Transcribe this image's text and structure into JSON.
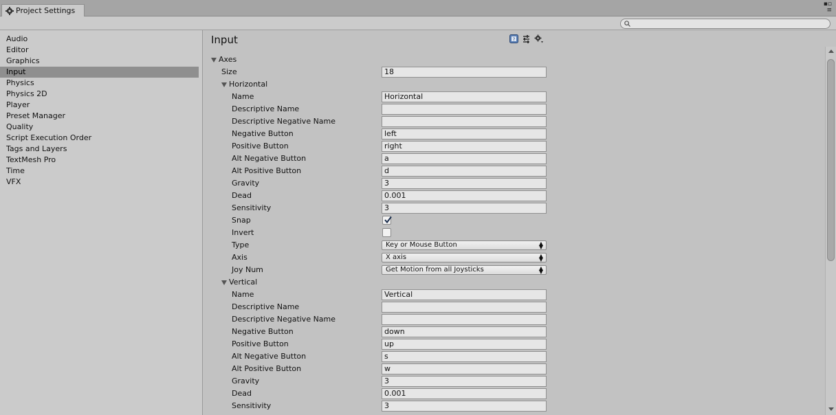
{
  "window": {
    "tab_title": "Project Settings",
    "icons": {
      "tab": "gear-icon",
      "controls": [
        "window-menu-icon",
        "context-menu-icon"
      ]
    }
  },
  "sidebar": {
    "items": [
      {
        "label": "Audio"
      },
      {
        "label": "Editor"
      },
      {
        "label": "Graphics"
      },
      {
        "label": "Input",
        "active": true
      },
      {
        "label": "Physics"
      },
      {
        "label": "Physics 2D"
      },
      {
        "label": "Player"
      },
      {
        "label": "Preset Manager"
      },
      {
        "label": "Quality"
      },
      {
        "label": "Script Execution Order"
      },
      {
        "label": "Tags and Layers"
      },
      {
        "label": "TextMesh Pro"
      },
      {
        "label": "Time"
      },
      {
        "label": "VFX"
      }
    ]
  },
  "search": {
    "placeholder": ""
  },
  "main": {
    "title": "Input",
    "header_icons": [
      "help-icon",
      "presets-icon",
      "settings-icon"
    ],
    "axes_label": "Axes",
    "size_label": "Size",
    "size_value": "18",
    "horizontal": {
      "foldout": "Horizontal",
      "name_label": "Name",
      "name_value": "Horizontal",
      "desc_name_label": "Descriptive Name",
      "desc_name_value": "",
      "desc_neg_label": "Descriptive Negative Name",
      "desc_neg_value": "",
      "neg_btn_label": "Negative Button",
      "neg_btn_value": "left",
      "pos_btn_label": "Positive Button",
      "pos_btn_value": "right",
      "alt_neg_label": "Alt Negative Button",
      "alt_neg_value": "a",
      "alt_pos_label": "Alt Positive Button",
      "alt_pos_value": "d",
      "gravity_label": "Gravity",
      "gravity_value": "3",
      "dead_label": "Dead",
      "dead_value": "0.001",
      "sensitivity_label": "Sensitivity",
      "sensitivity_value": "3",
      "snap_label": "Snap",
      "snap_checked": true,
      "invert_label": "Invert",
      "invert_checked": false,
      "type_label": "Type",
      "type_value": "Key or Mouse Button",
      "axis_label": "Axis",
      "axis_value": "X axis",
      "joy_label": "Joy Num",
      "joy_value": "Get Motion from all Joysticks"
    },
    "vertical": {
      "foldout": "Vertical",
      "name_label": "Name",
      "name_value": "Vertical",
      "desc_name_label": "Descriptive Name",
      "desc_name_value": "",
      "desc_neg_label": "Descriptive Negative Name",
      "desc_neg_value": "",
      "neg_btn_label": "Negative Button",
      "neg_btn_value": "down",
      "pos_btn_label": "Positive Button",
      "pos_btn_value": "up",
      "alt_neg_label": "Alt Negative Button",
      "alt_neg_value": "s",
      "alt_pos_label": "Alt Positive Button",
      "alt_pos_value": "w",
      "gravity_label": "Gravity",
      "gravity_value": "3",
      "dead_label": "Dead",
      "dead_value": "0.001",
      "sensitivity_label": "Sensitivity",
      "sensitivity_value": "3"
    }
  }
}
